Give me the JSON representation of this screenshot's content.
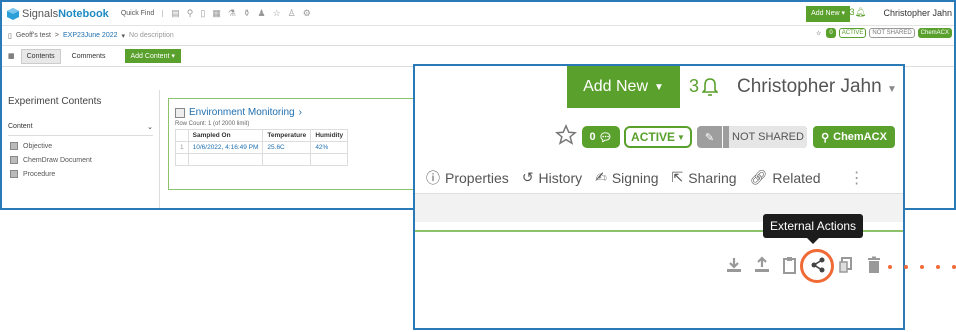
{
  "background": {
    "logo": {
      "signals": "Signals",
      "notebook": "Notebook"
    },
    "quick_find": "Quick Find",
    "add_new": "Add New",
    "notification_count": "3",
    "user": "Christopher Jahn",
    "breadcrumb": {
      "root": "Geoff's test",
      "sep": ">",
      "experiment": "EXP23June 2022",
      "description": "No description"
    },
    "mini_status": [
      "0",
      "ACTIVE",
      "NOT SHARED",
      "ChemACX"
    ],
    "tabs": {
      "contents": "Contents",
      "comments": "Comments",
      "add_content": "Add Content"
    },
    "sidebar": {
      "heading": "Experiment Contents",
      "group": "Content",
      "items": [
        "Objective",
        "ChemDraw Document",
        "Procedure"
      ]
    },
    "card": {
      "title": "Environment Monitoring",
      "row_count": "Row Count: 1 (of 2000 limit)",
      "columns": [
        "Sampled On",
        "Temperature",
        "Humidity"
      ],
      "rows": [
        [
          "10/6/2022, 4:16:49 PM",
          "25.6C",
          "42%"
        ]
      ]
    },
    "related_tab": "Related"
  },
  "zoom": {
    "add_new": "Add New",
    "notification_count": "3",
    "user": "Christopher Jahn",
    "comments_count": "0",
    "status": "ACTIVE",
    "sharing": "NOT SHARED",
    "chemacx": "ChemACX",
    "tabs": [
      "Properties",
      "History",
      "Signing",
      "Sharing",
      "Related"
    ],
    "tooltip": "External Actions"
  },
  "colors": {
    "green": "#5aa02c",
    "blue_border": "#2a7ab8",
    "highlight": "#f06a35"
  }
}
